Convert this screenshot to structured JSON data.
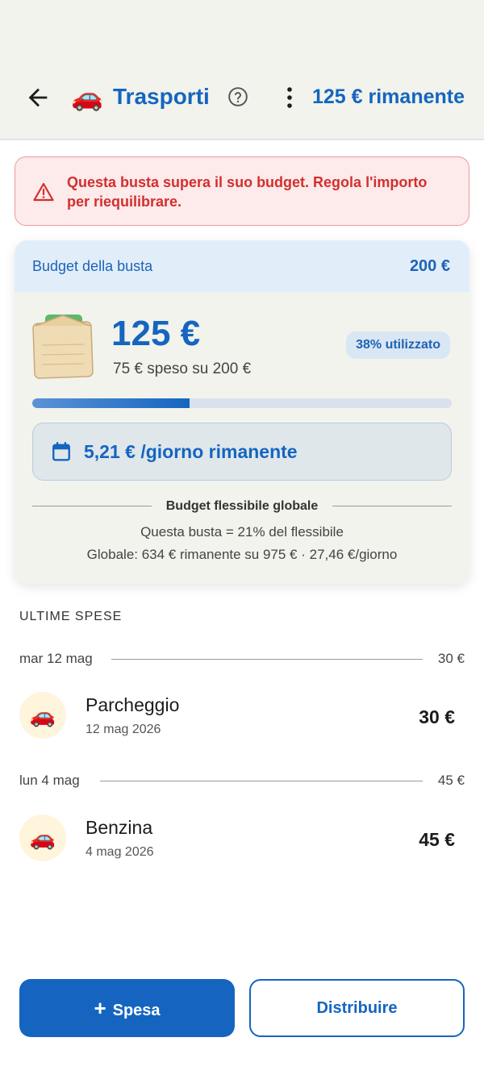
{
  "header": {
    "category_emoji": "🚗",
    "title": "Trasporti",
    "remaining": "125 € rimanente"
  },
  "alert": {
    "text": "Questa busta supera il suo budget. Regola l'importo per riequilibrare."
  },
  "budget_card": {
    "label": "Budget della busta",
    "budget": "200 €",
    "remaining_amount": "125 €",
    "spent_summary": "75 € speso su 200 €",
    "used_badge": "38% utilizzato",
    "progress_fraction": 0.375,
    "per_day": "5,21 € /giorno rimanente",
    "flexible_title": "Budget flessibile globale",
    "flexible_share": "Questa busta = 21% del flessibile",
    "flexible_global": "Globale: 634 € rimanente su 975 € · 27,46 €/giorno"
  },
  "expenses": {
    "section_title": "ULTIME SPESE",
    "days": [
      {
        "label": "mar 12 mag",
        "total": "30 €",
        "items": [
          {
            "emoji": "🚗",
            "name": "Parcheggio",
            "date": "12 mag 2026",
            "amount": "30 €"
          }
        ]
      },
      {
        "label": "lun 4 mag",
        "total": "45 €",
        "items": [
          {
            "emoji": "🚗",
            "name": "Benzina",
            "date": "4 mag 2026",
            "amount": "45 €"
          }
        ]
      }
    ]
  },
  "actions": {
    "primary_label": "Spesa",
    "primary_icon": "+",
    "secondary_label": "Distribuire"
  },
  "colors": {
    "accent": "#1565c0",
    "alert": "#d32f2f",
    "alert_bg": "#fdeaea"
  },
  "icons": {
    "back": "arrow-left-icon",
    "help": "help-circle-icon",
    "more": "more-vert-icon",
    "warning": "warning-triangle-icon",
    "calendar": "calendar-icon",
    "envelope": "envelope-icon"
  }
}
